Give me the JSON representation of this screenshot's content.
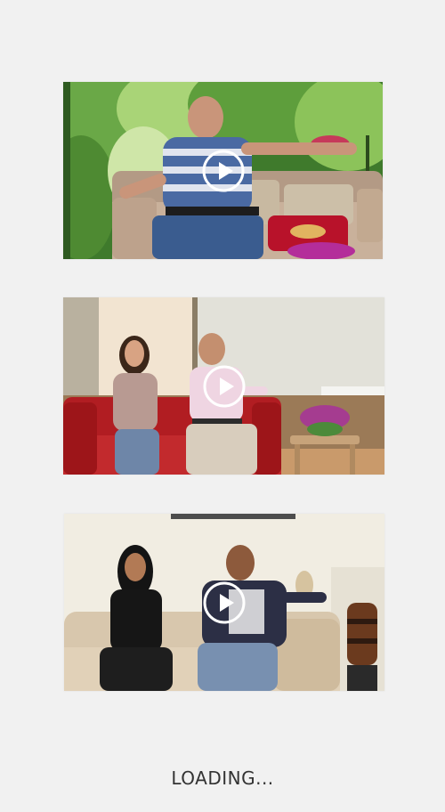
{
  "videos": [
    {
      "id": "video-1",
      "play_icon": "play-circle-icon",
      "thumbnail": "man-in-striped-shirt-on-couch"
    },
    {
      "id": "video-2",
      "play_icon": "play-circle-icon",
      "thumbnail": "couple-on-red-sofa"
    },
    {
      "id": "video-3",
      "play_icon": "play-circle-icon",
      "thumbnail": "couple-on-beige-sofa"
    }
  ],
  "loading": {
    "text": "LOADING..."
  },
  "colors": {
    "page_background": "#f1f1f1",
    "loading_text": "#333333",
    "play_icon": "#ffffff"
  }
}
